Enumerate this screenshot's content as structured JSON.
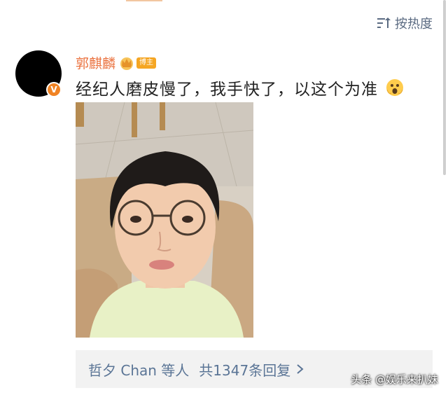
{
  "sort": {
    "label": "按热度",
    "icon": "sort-icon"
  },
  "post": {
    "author": "郭麒麟",
    "role_badge": "博主",
    "text": "经纪人磨皮慢了，我手快了，以这个为准",
    "emoji": "scared-face-emoji",
    "photo": "selfie-photo"
  },
  "comments": {
    "names": "哲夕 Chan 等人",
    "summary": "共1347条回复",
    "chevron": ">"
  },
  "watermark": "头条 @娱乐来扒妹",
  "colors": {
    "username": "#eb7340",
    "link": "#5b7596",
    "verified": "#f08324",
    "badge": "#f5a623"
  }
}
